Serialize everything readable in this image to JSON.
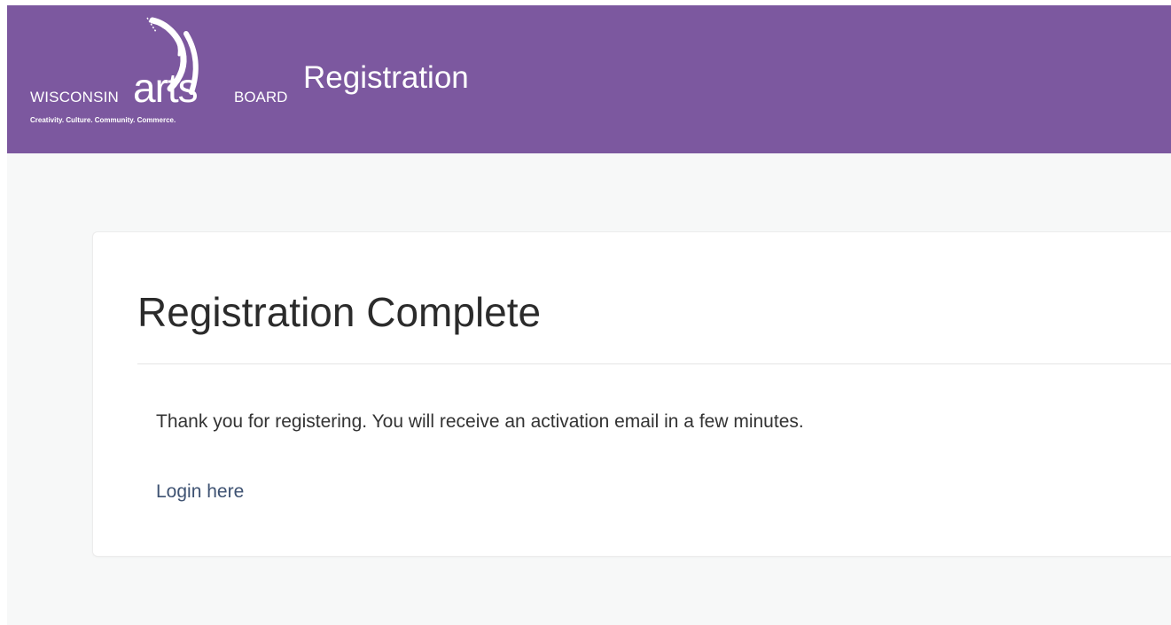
{
  "header": {
    "logo": {
      "left_text": "WISCONSIN",
      "middle_text": "arts",
      "right_text": "BOARD",
      "tagline": "Creativity. Culture. Community. Commerce."
    },
    "title": "Registration",
    "background_color": "#7c589f"
  },
  "main": {
    "card": {
      "title": "Registration Complete",
      "message": "Thank you for registering. You will receive an activation email in a few minutes.",
      "login_link_label": "Login here",
      "link_color": "#3e5272"
    }
  }
}
